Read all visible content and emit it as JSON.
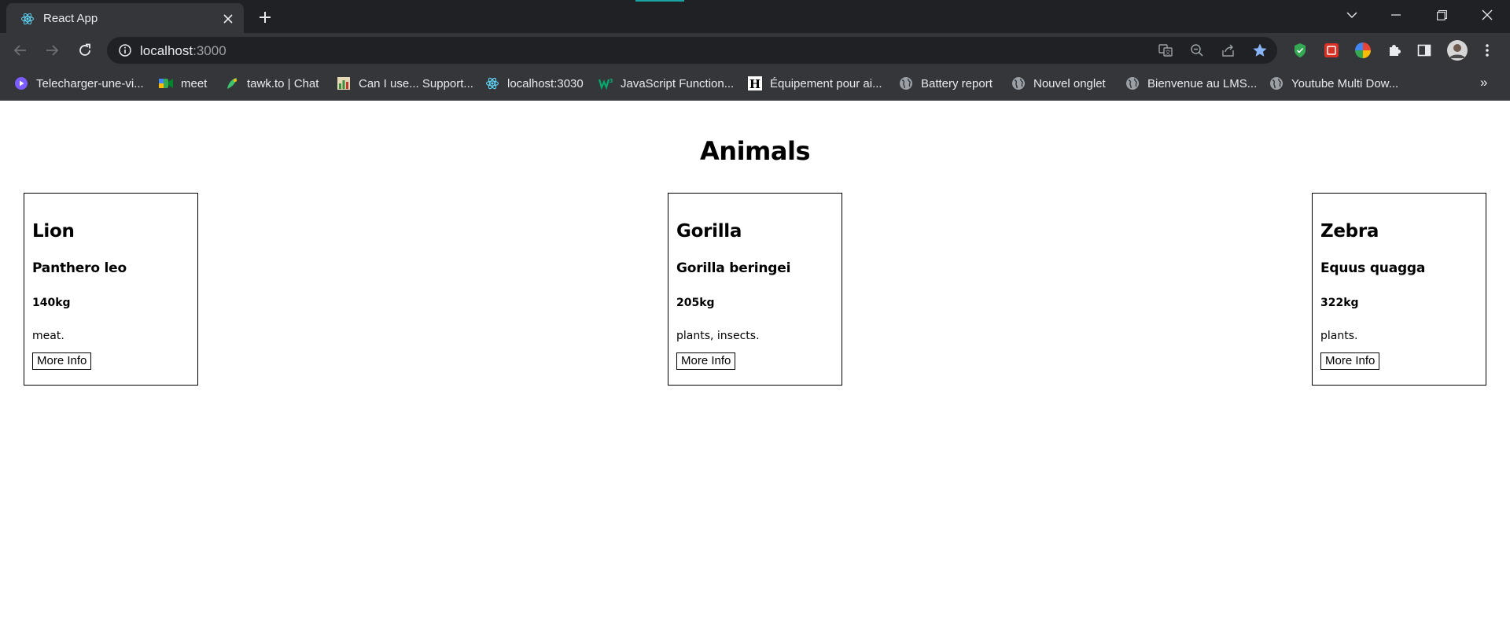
{
  "browser": {
    "tab": {
      "title": "React App",
      "favicon": "react-icon"
    },
    "address_bar": {
      "host": "localhost",
      "port": ":3000"
    },
    "bookmarks": [
      {
        "label": "Telecharger-une-vi...",
        "icon": "play-circle-icon",
        "color": "#7b5cff"
      },
      {
        "label": "meet",
        "icon": "meet-icon",
        "color": "#34a853"
      },
      {
        "label": "tawk.to | Chat",
        "icon": "tawk-icon",
        "color": "#3ec46d"
      },
      {
        "label": "Can I use... Support...",
        "icon": "caniuse-icon",
        "color": "#c9b27c"
      },
      {
        "label": "localhost:3030",
        "icon": "react-icon",
        "color": "#61dafb"
      },
      {
        "label": "JavaScript Function...",
        "icon": "w3schools-icon",
        "color": "#04aa6d"
      },
      {
        "label": "Équipement pour ai...",
        "icon": "h-logo-icon",
        "color": "#ffffff"
      },
      {
        "label": "Battery report",
        "icon": "globe-icon",
        "color": "#9aa0a6"
      },
      {
        "label": "Nouvel onglet",
        "icon": "globe-icon",
        "color": "#9aa0a6"
      },
      {
        "label": "Bienvenue au LMS...",
        "icon": "globe-icon",
        "color": "#9aa0a6"
      },
      {
        "label": "Youtube Multi Dow...",
        "icon": "globe-icon",
        "color": "#9aa0a6"
      }
    ],
    "bookmarks_overflow": "»"
  },
  "page": {
    "title": "Animals",
    "animals": [
      {
        "name": "Lion",
        "scientific_name": "Panthero leo",
        "weight": "140kg",
        "diet": "meat.",
        "button": "More Info"
      },
      {
        "name": "Gorilla",
        "scientific_name": "Gorilla beringei",
        "weight": "205kg",
        "diet": "plants, insects.",
        "button": "More Info"
      },
      {
        "name": "Zebra",
        "scientific_name": "Equus quagga",
        "weight": "322kg",
        "diet": "plants.",
        "button": "More Info"
      }
    ]
  }
}
